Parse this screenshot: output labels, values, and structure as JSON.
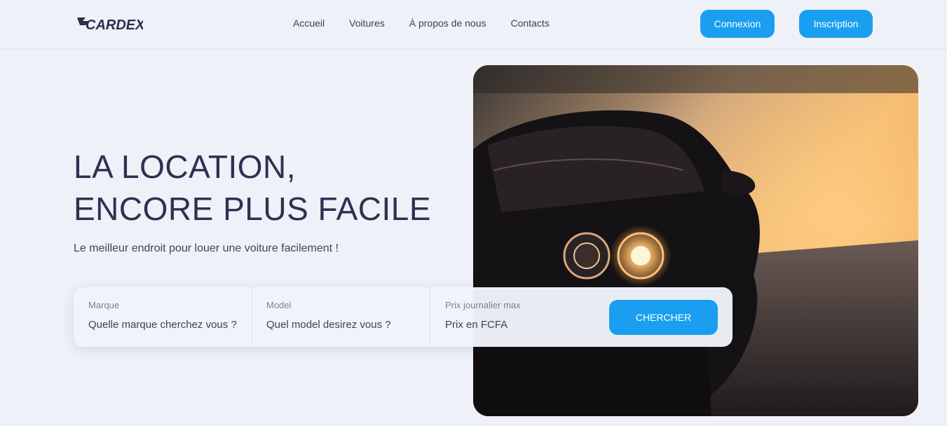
{
  "brand": {
    "logo_text": "CARDEX"
  },
  "nav": {
    "links": [
      "Accueil",
      "Voitures",
      "À propos de nous",
      "Contacts"
    ],
    "login_label": "Connexion",
    "signup_label": "Inscription"
  },
  "hero": {
    "title_line1": "LA LOCATION,",
    "title_line2": "ENCORE PLUS FACILE",
    "subtitle": "Le meilleur endroit pour louer une voiture facilement !"
  },
  "search": {
    "brand_label": "Marque",
    "brand_placeholder": "Quelle marque cherchez vous ?",
    "model_label": "Model",
    "model_placeholder": "Quel model desirez vous ?",
    "price_label": "Prix journalier max",
    "price_placeholder": "Prix en FCFA",
    "button_label": "CHERCHER"
  },
  "colors": {
    "accent": "#1a9ef0",
    "background": "#eef1f8",
    "text": "#2e3150"
  }
}
